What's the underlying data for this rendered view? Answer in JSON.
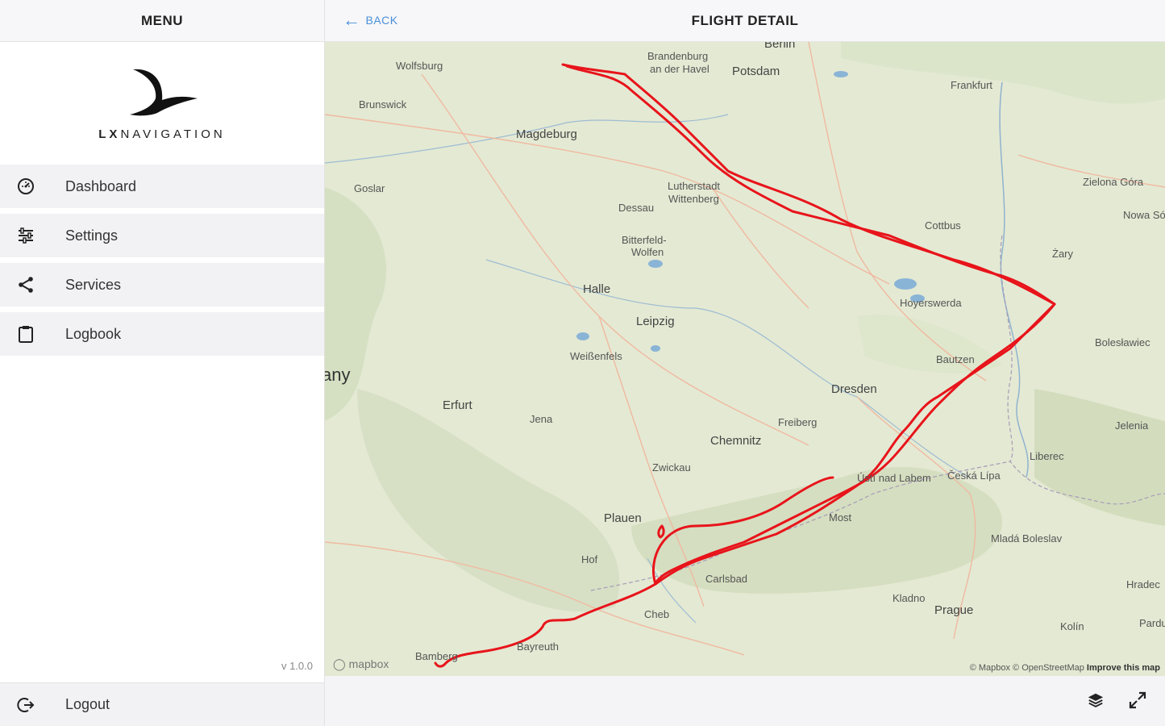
{
  "sidebar": {
    "header": "MENU",
    "brand": {
      "text_bold": "LX",
      "text_rest": "NAVIGATION"
    },
    "items": [
      {
        "label": "Dashboard",
        "icon": "dashboard-icon"
      },
      {
        "label": "Settings",
        "icon": "sliders-icon"
      },
      {
        "label": "Services",
        "icon": "share-icon"
      },
      {
        "label": "Logbook",
        "icon": "clipboard-icon"
      }
    ],
    "version": "v 1.0.0",
    "logout": {
      "label": "Logout",
      "icon": "logout-icon"
    }
  },
  "header": {
    "back_label": "BACK",
    "title": "FLIGHT DETAIL"
  },
  "map": {
    "labels": [
      "Wolfsburg",
      "Brandenburg",
      "an der Havel",
      "Berlin",
      "Potsdam",
      "Frankfurt",
      "Brunswick",
      "Magdeburg",
      "Goslar",
      "Lutherstadt",
      "Wittenberg",
      "Dessau",
      "Bitterfeld-",
      "Wolfen",
      "Cottbus",
      "Zielona Góra",
      "Nowa Sól",
      "Żary",
      "Halle",
      "Leipzig",
      "Hoyerswerda",
      "Weißenfels",
      "any",
      "Erfurt",
      "Jena",
      "Bautzen",
      "Dresden",
      "Freiberg",
      "Chemnitz",
      "Zwickau",
      "Bolesławiec",
      "Liberec",
      "Jelenia",
      "Ústí nad Labem",
      "Česká Lípa",
      "Most",
      "Plauen",
      "Hof",
      "Mladá Boleslav",
      "Carlsbad",
      "Cheb",
      "Kladno",
      "Prague",
      "Hradec",
      "Bayreuth",
      "Kolín",
      "Pardu",
      "Bamberg"
    ],
    "mapbox_logo": "mapbox",
    "attribution": "© Mapbox © OpenStreetMap",
    "attribution_link": "Improve this map",
    "track_color": "#e8141b"
  },
  "footer": {
    "layers_icon": "layers-icon",
    "expand_icon": "expand-icon"
  }
}
